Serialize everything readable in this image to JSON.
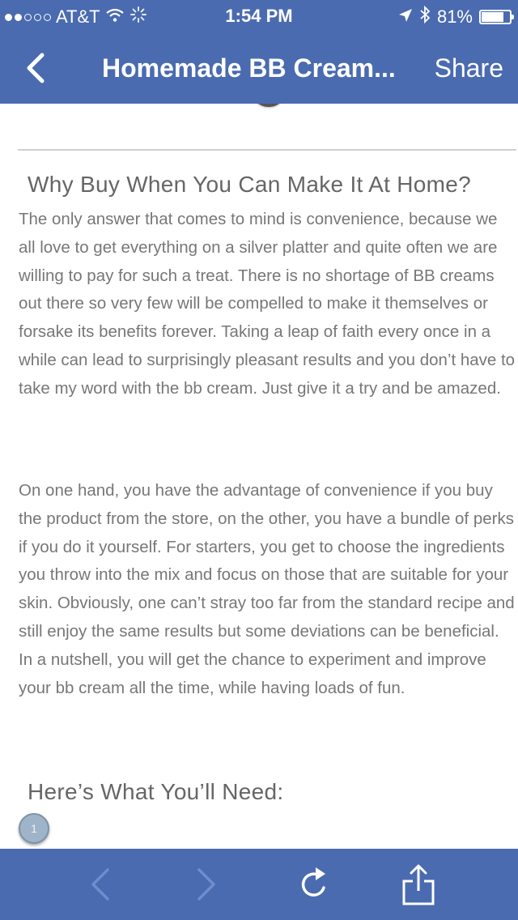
{
  "status_bar": {
    "carrier": "AT&T",
    "time": "1:54 PM",
    "battery_percent": "81%",
    "battery_level": 0.81,
    "signal_bars_filled": 2,
    "signal_bars_total": 5
  },
  "nav": {
    "title": "Homemade BB Cream...",
    "share_label": "Share",
    "back_icon": "chevron-left-icon"
  },
  "article": {
    "heading_why": "Why Buy When You Can Make It At Home?",
    "paragraph_1": "The only answer that comes to mind is convenience, because we all love to get everything on a silver platter and quite often we are willing to pay for such a treat. There is no shortage of BB creams out there so very few will be compelled to make it themselves or forsake its benefits forever. Taking a leap of faith every once in a while can lead to surprisingly pleasant results and you don’t have to take my word with the bb cream. Just give it a try and be amazed.",
    "paragraph_2": "On one hand, you have the advantage of convenience if you buy the product from the store, on the other, you have a bundle of perks if you do it yourself. For starters, you get to choose the ingredients you throw into the mix and focus on those that are suitable for your skin. Obviously, one can’t stray too far from the standard recipe and still enjoy the same results but some deviations can be beneficial. In a nutshell, you will get the chance to experiment and improve your bb cream all the time, while having loads of fun.",
    "heading_need": "Here’s What You’ll Need:",
    "list_number": "1"
  },
  "toolbar": {
    "icons": [
      "back-arrow-icon",
      "forward-arrow-icon",
      "refresh-icon",
      "share-icon"
    ]
  },
  "colors": {
    "bar_blue": "#4a6bb0",
    "text_gray": "#777777",
    "heading_gray": "#666666"
  }
}
